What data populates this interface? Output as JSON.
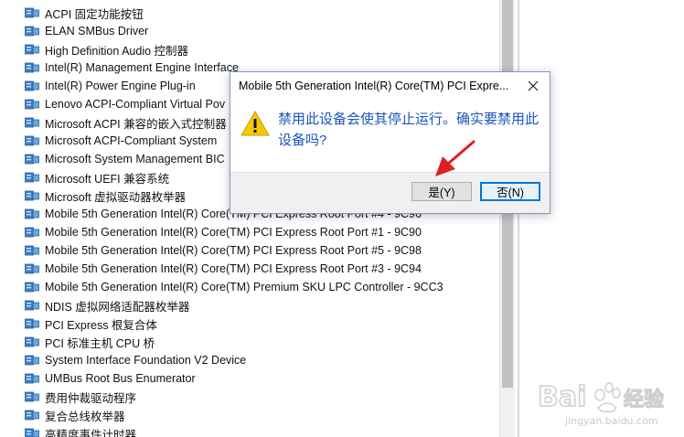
{
  "devices": [
    "ACPI 固定功能按钮",
    "ELAN SMBus Driver",
    "High Definition Audio 控制器",
    "Intel(R) Management Engine Interface",
    "Intel(R) Power Engine Plug-in",
    "Lenovo ACPI-Compliant Virtual Pov",
    "Microsoft ACPI 兼容的嵌入式控制器",
    "Microsoft ACPI-Compliant System",
    "Microsoft System Management BIC",
    "Microsoft UEFI 兼容系统",
    "Microsoft 虚拟驱动器枚举器",
    "Mobile 5th Generation Intel(R) Core(TM) PCI Express Root Port #4 - 9C96",
    "Mobile 5th Generation Intel(R) Core(TM) PCI Express Root Port #1 - 9C90",
    "Mobile 5th Generation Intel(R) Core(TM) PCI Express Root Port #5 - 9C98",
    "Mobile 5th Generation Intel(R) Core(TM) PCI Express Root Port #3 - 9C94",
    "Mobile 5th Generation Intel(R) Core(TM) Premium SKU LPC Controller - 9CC3",
    "NDIS 虚拟网络适配器枚举器",
    "PCI Express 根复合体",
    "PCI 标准主机 CPU 桥",
    "System Interface Foundation V2 Device",
    "UMBus Root Bus Enumerator",
    "费用仲裁驱动程序",
    "复合总线枚举器",
    "高精度事件计时器"
  ],
  "dialog": {
    "title": "Mobile 5th Generation Intel(R) Core(TM) PCI Expre...",
    "message": "禁用此设备会使其停止运行。确实要禁用此设备吗?",
    "yes_label": "是(Y)",
    "no_label": "否(N)"
  },
  "watermark": {
    "brand": "Bai",
    "brand_cn": "经验",
    "url": "jingyan.baidu.com"
  },
  "colors": {
    "message": "#1a55b8",
    "arrow": "#e02020",
    "accent": "#0078d7"
  }
}
